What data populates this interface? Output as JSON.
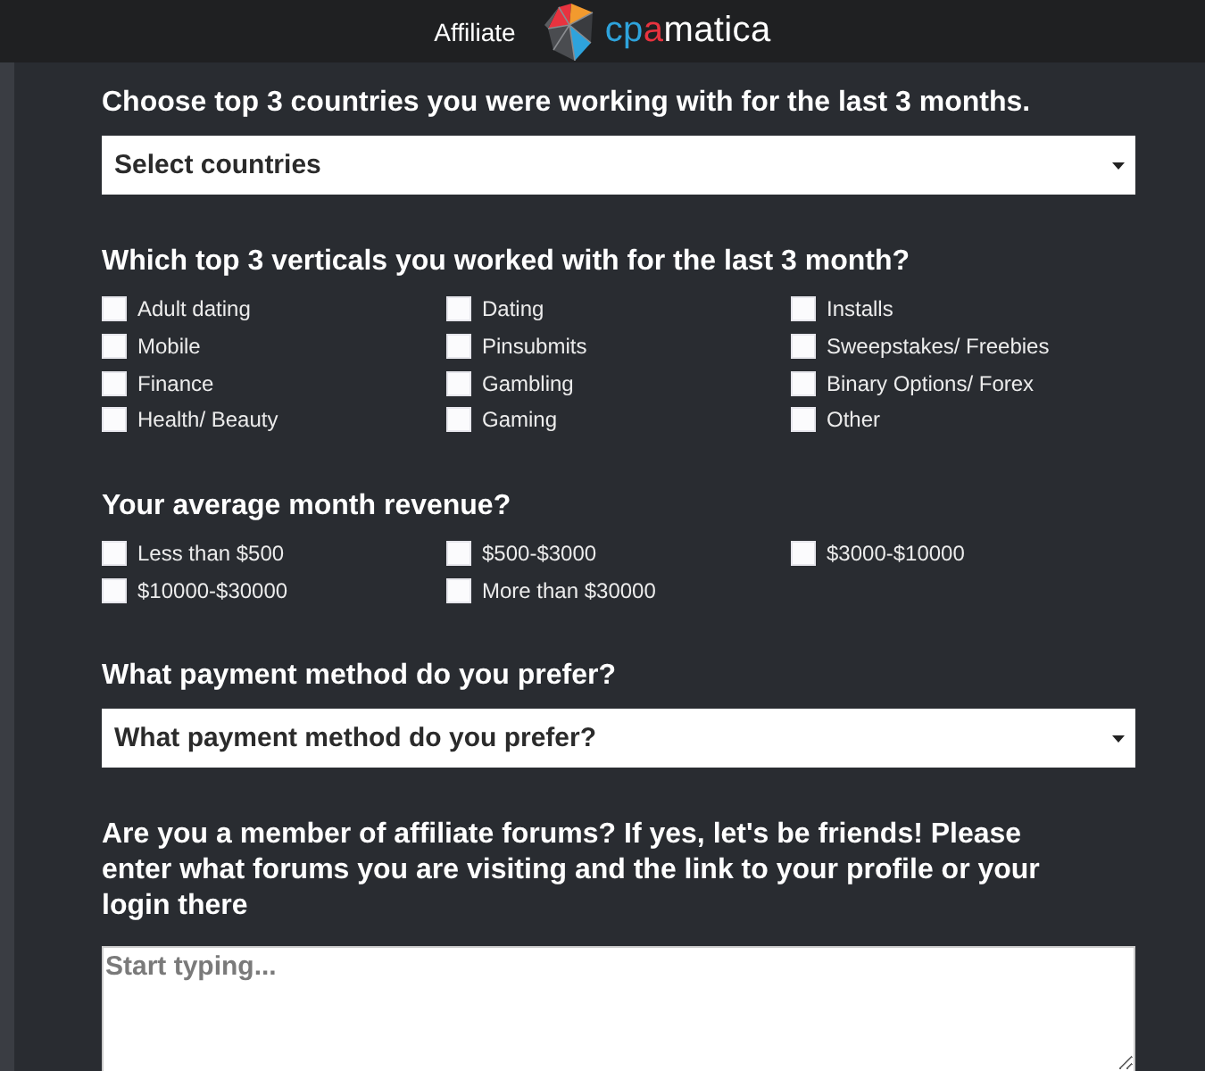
{
  "header": {
    "label": "Affiliate",
    "logo_text": "cpamatica"
  },
  "questions": [
    {
      "kind": "select",
      "title": "Choose top 3 countries you were working with for the last 3 months.",
      "value": "Select countries"
    },
    {
      "kind": "checkboxes",
      "title": "Which top 3 verticals you worked with for the last 3 month?",
      "options": [
        {
          "label": "Adult dating",
          "checked": false
        },
        {
          "label": "Dating",
          "checked": false
        },
        {
          "label": "Installs",
          "checked": false
        },
        {
          "label": "Mobile",
          "checked": false
        },
        {
          "label": "Pinsubmits",
          "checked": false
        },
        {
          "label": "Sweepstakes/ Freebies",
          "checked": false
        },
        {
          "label": "Finance",
          "checked": false
        },
        {
          "label": "Gambling",
          "checked": false
        },
        {
          "label": "Binary Options/ Forex",
          "checked": false
        },
        {
          "label": "Health/ Beauty",
          "checked": false
        },
        {
          "label": "Gaming",
          "checked": false
        },
        {
          "label": "Other",
          "checked": false
        }
      ]
    },
    {
      "kind": "checkboxes",
      "title": "Your average month revenue?",
      "options": [
        {
          "label": "Less than $500",
          "checked": false
        },
        {
          "label": "$500-$3000",
          "checked": false
        },
        {
          "label": "$3000-$10000",
          "checked": false
        },
        {
          "label": "$10000-$30000",
          "checked": false
        },
        {
          "label": "More than $30000",
          "checked": false
        }
      ]
    },
    {
      "kind": "select",
      "title": "What payment method do you prefer?",
      "value": "What payment method do you prefer?"
    },
    {
      "kind": "textarea",
      "title": "Are you a member of affiliate forums? If yes, let's be friends! Please enter what forums you are visiting and the link to your profile or your login there",
      "placeholder": "Start typing..."
    }
  ]
}
